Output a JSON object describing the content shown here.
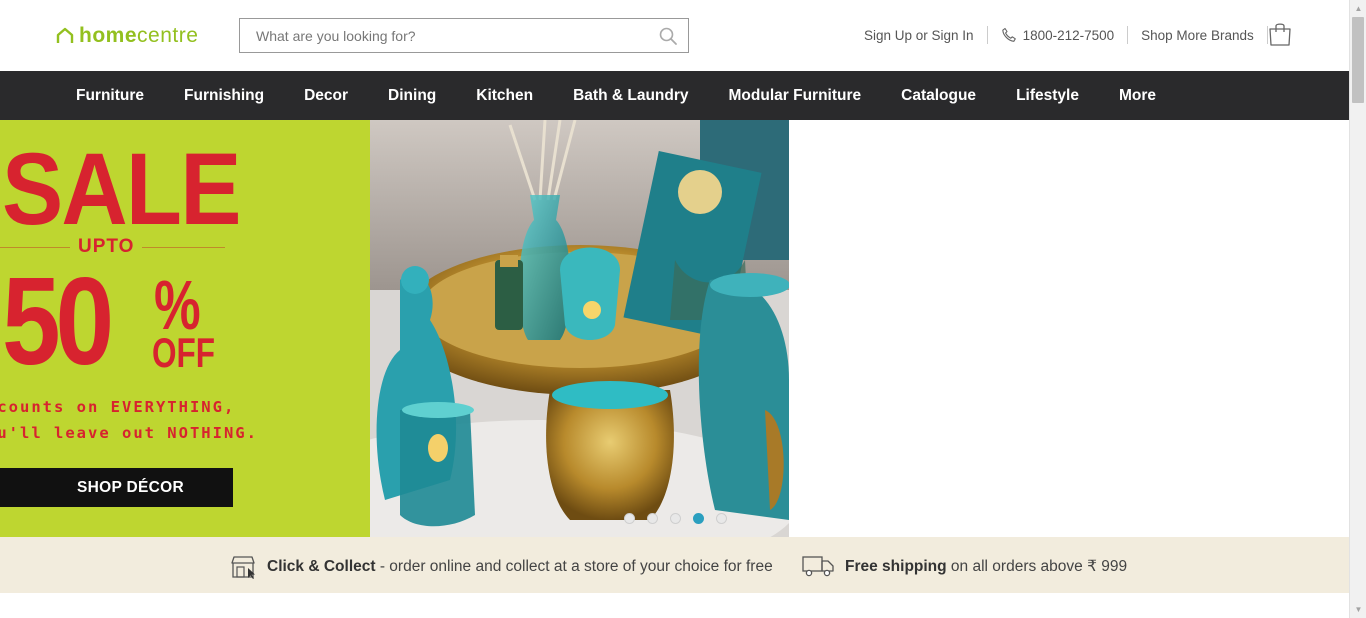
{
  "header": {
    "logo_bold": "home",
    "logo_normal": "centre",
    "search_placeholder": "What are you looking for?",
    "signin": "Sign Up or Sign In",
    "phone": "1800-212-7500",
    "shop_more": "Shop More Brands"
  },
  "nav": {
    "items": [
      "Furniture",
      "Furnishing",
      "Decor",
      "Dining",
      "Kitchen",
      "Bath & Laundry",
      "Modular Furniture",
      "Catalogue",
      "Lifestyle",
      "More"
    ]
  },
  "hero": {
    "sale": "SALE",
    "upto": "UPTO",
    "fifty": "50",
    "pct": "%",
    "off": "OFF",
    "line1": "scounts on EVERYTHING,",
    "line2": "ou'll leave out NOTHING.",
    "cta": "SHOP DÉCOR",
    "active_slide": 4,
    "slide_count": 5
  },
  "info": {
    "click_title": "Click & Collect",
    "click_text": " - order online and collect at a store of your choice for free",
    "ship_title": "Free shipping",
    "ship_text": " on all orders above ₹ 999"
  },
  "colors": {
    "brand": "#93c01f",
    "nav_bg": "#2a2a2c",
    "promo_bg": "#bed630",
    "promo_red": "#d7232f",
    "info_bg": "#f2ecdd",
    "dot_active": "#2a9fbf"
  }
}
